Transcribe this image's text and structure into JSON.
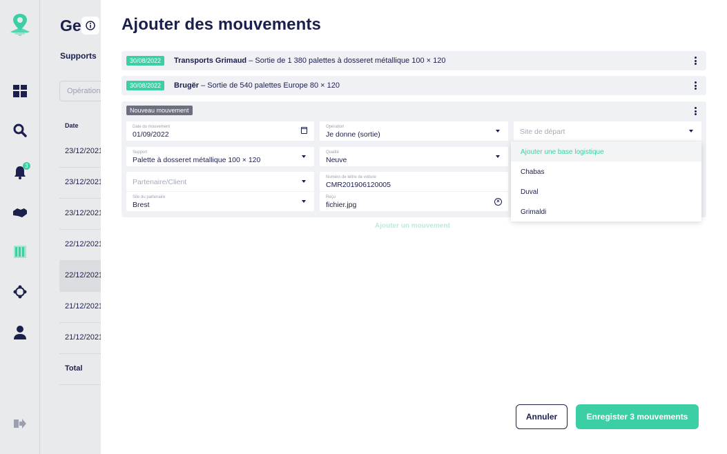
{
  "background": {
    "title": "Ge",
    "tab": "Supports",
    "search_placeholder": "Opération",
    "col_date": "Date",
    "rows": [
      "23/12/2021",
      "23/12/2021",
      "23/12/2021",
      "22/12/2021",
      "22/12/2021",
      "21/12/2021",
      "21/12/2021"
    ],
    "total": "Total"
  },
  "sidebar": {
    "notifications_count": "3"
  },
  "modal": {
    "title": "Ajouter des mouvements",
    "movements": [
      {
        "date": "30/08/2022",
        "partner": "Transports Grimaud",
        "text": " – Sortie de 1 380 palettes à dosseret métallique 100 × 120"
      },
      {
        "date": "30/08/2022",
        "partner": "Brugër",
        "text": " – Sortie de 540 palettes Europe 80 × 120"
      }
    ],
    "new_tag": "Nouveau mouvement",
    "fields": {
      "date_label": "Date du mouvement",
      "date_value": "01/09/2022",
      "operation_label": "Opération",
      "operation_value": "Je donne (sortie)",
      "site_placeholder": "Site de départ",
      "support_label": "Support",
      "support_value": "Palette à dosseret métallique 100 × 120",
      "quality_label": "Qualité",
      "quality_value": "Neuve",
      "partner_placeholder": "Partenaire/Client",
      "cmr_label": "Numéro de lettre de voiture",
      "cmr_value": "CMR201906120005",
      "partner_site_label": "Site du partenaire",
      "partner_site_value": "Brest",
      "receipt_label": "Reçu",
      "receipt_value": "fichier.jpg"
    },
    "dropdown_options": [
      "Ajouter une base logistique",
      "Chabas",
      "Duval",
      "Grimaldi"
    ],
    "add_movement": "Ajouter un mouvement",
    "cancel": "Annuler",
    "save": "Enregister 3 mouvements"
  }
}
